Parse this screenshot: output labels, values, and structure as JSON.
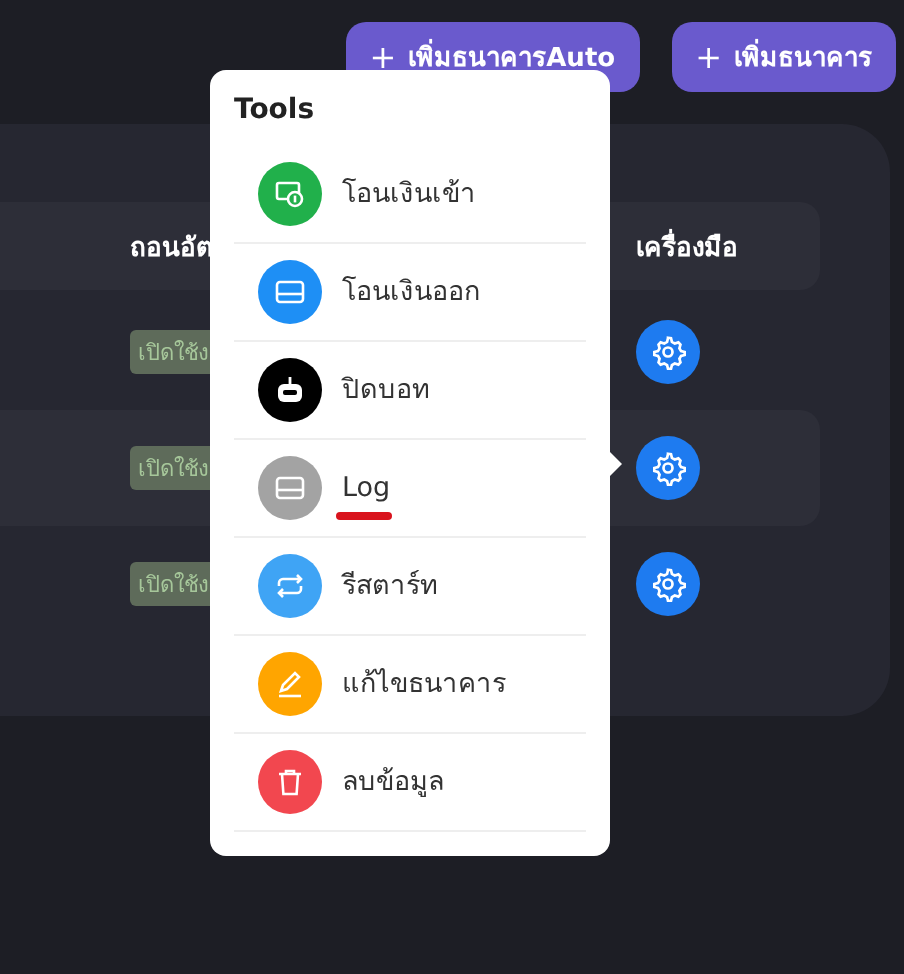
{
  "header_buttons": [
    {
      "icon": "+",
      "label": "เพิ่มธนาคารAuto"
    },
    {
      "icon": "+",
      "label": "เพิ่มธนาคาร"
    }
  ],
  "table": {
    "columns": [
      "ถอนอัต",
      "เครื่องมือ"
    ],
    "rows": [
      {
        "status": "เปิดใช้ง",
        "selected": false
      },
      {
        "status": "เปิดใช้ง",
        "selected": true
      },
      {
        "status": "เปิดใช้ง",
        "selected": false
      }
    ]
  },
  "tools_menu": {
    "title": "Tools",
    "items": [
      {
        "label": "โอนเงินเข้า",
        "color": "#21b04b",
        "underlined": false
      },
      {
        "label": "โอนเงินออก",
        "color": "#1e8ff5",
        "underlined": false
      },
      {
        "label": "ปิดบอท",
        "color": "#000000",
        "underlined": false
      },
      {
        "label": "Log",
        "color": "#a3a3a3",
        "underlined": true
      },
      {
        "label": "รีสตาร์ท",
        "color": "#3fa4f5",
        "underlined": false
      },
      {
        "label": "แก้ไขธนาคาร",
        "color": "#ffa500",
        "underlined": false
      },
      {
        "label": "ลบข้อมูล",
        "color": "#f2474f",
        "underlined": false
      }
    ]
  }
}
